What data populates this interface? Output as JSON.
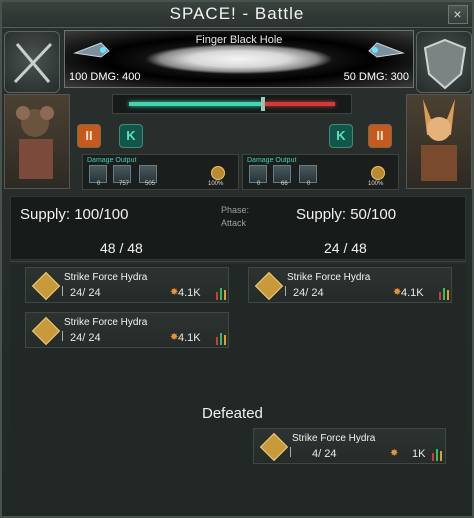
{
  "title": "SPACE! - Battle",
  "close": "×",
  "banner": {
    "title": "Finger Black Hole",
    "left_dmg": "100 DMG: 400",
    "right_dmg": "50 DMG: 300"
  },
  "left": {
    "damage_output_label": "Damage Output",
    "damage_values": [
      "0",
      "757",
      "505"
    ],
    "damage_pct": "100%",
    "supply": "Supply: 100/100",
    "count": "48 / 48",
    "fleets": [
      {
        "name": "Strike Force Hydra",
        "crew": "24/ 24",
        "dmg": "4.1K"
      },
      {
        "name": "Strike Force Hydra",
        "crew": "24/ 24",
        "dmg": "4.1K"
      }
    ]
  },
  "right": {
    "damage_output_label": "Damage Output",
    "damage_values": [
      "0",
      "66",
      "0"
    ],
    "damage_pct": "100%",
    "supply": "Supply: 50/100",
    "count": "24 / 48",
    "fleets": [
      {
        "name": "Strike Force Hydra",
        "crew": "24/ 24",
        "dmg": "4.1K"
      }
    ],
    "defeated_label": "Defeated",
    "defeated": [
      {
        "name": "Strike Force Hydra",
        "crew": "4/ 24",
        "dmg": "1K"
      }
    ]
  },
  "phase": {
    "label": "Phase:",
    "value": "Attack"
  },
  "controls": {
    "pause_glyph": "II",
    "stance_glyph": "K"
  },
  "colors": {
    "friendly": "#41d6b1",
    "enemy": "#d23a3a",
    "accent": "#c55a1f"
  }
}
